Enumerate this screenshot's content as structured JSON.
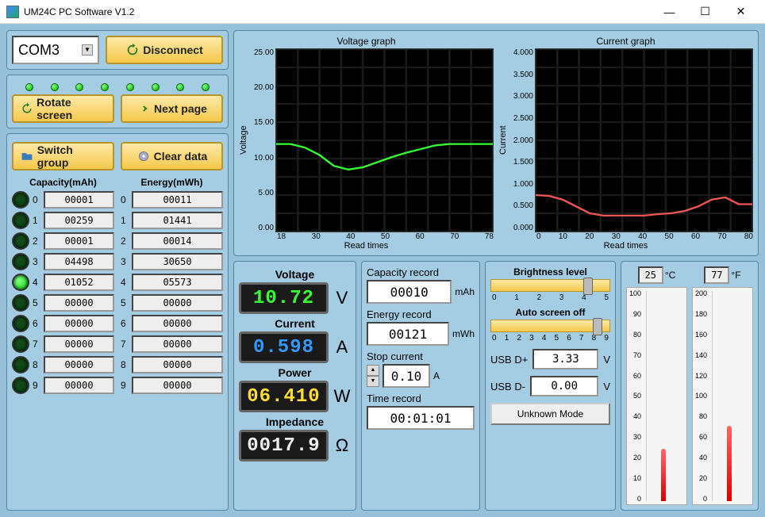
{
  "window": {
    "title": "UM24C PC Software V1.2"
  },
  "conn": {
    "port": "COM3",
    "disconnect": "Disconnect"
  },
  "nav": {
    "rotate": "Rotate screen",
    "next": "Next page",
    "switch": "Switch group",
    "clear": "Clear data"
  },
  "slots": {
    "cap_head": "Capacity(mAh)",
    "eng_head": "Energy(mWh)",
    "rows": [
      {
        "n": "0",
        "cap": "00001",
        "eng": "00011",
        "on": false
      },
      {
        "n": "1",
        "cap": "00259",
        "eng": "01441",
        "on": false
      },
      {
        "n": "2",
        "cap": "00001",
        "eng": "00014",
        "on": false
      },
      {
        "n": "3",
        "cap": "04498",
        "eng": "30650",
        "on": false
      },
      {
        "n": "4",
        "cap": "01052",
        "eng": "05573",
        "on": true
      },
      {
        "n": "5",
        "cap": "00000",
        "eng": "00000",
        "on": false
      },
      {
        "n": "6",
        "cap": "00000",
        "eng": "00000",
        "on": false
      },
      {
        "n": "7",
        "cap": "00000",
        "eng": "00000",
        "on": false
      },
      {
        "n": "8",
        "cap": "00000",
        "eng": "00000",
        "on": false
      },
      {
        "n": "9",
        "cap": "00000",
        "eng": "00000",
        "on": false
      }
    ]
  },
  "charts": {
    "voltage": {
      "title": "Voltage graph",
      "ylabel": "Voltage",
      "xlabel": "Read times",
      "yticks": [
        "25.00",
        "20.00",
        "15.00",
        "10.00",
        "5.00",
        "0.00"
      ],
      "xticks": [
        "18",
        "30",
        "40",
        "50",
        "60",
        "70",
        "78"
      ]
    },
    "current": {
      "title": "Current graph",
      "ylabel": "Current",
      "xlabel": "Read times",
      "yticks": [
        "4.000",
        "3.500",
        "3.000",
        "2.500",
        "2.000",
        "1.500",
        "1.000",
        "0.500",
        "0.000"
      ],
      "xticks": [
        "0",
        "10",
        "20",
        "30",
        "40",
        "50",
        "60",
        "70",
        "80"
      ]
    }
  },
  "chart_data": [
    {
      "type": "line",
      "title": "Voltage graph",
      "xlabel": "Read times",
      "ylabel": "Voltage",
      "xlim": [
        18,
        78
      ],
      "ylim": [
        0,
        25
      ],
      "series": [
        {
          "name": "Voltage",
          "color": "#3f3",
          "x": [
            18,
            22,
            26,
            30,
            34,
            38,
            42,
            46,
            50,
            54,
            58,
            62,
            66,
            70,
            74,
            78
          ],
          "values": [
            12.0,
            12.0,
            11.5,
            10.5,
            9.0,
            8.5,
            8.8,
            9.5,
            10.2,
            10.8,
            11.3,
            11.8,
            12.0,
            12.0,
            12.0,
            12.0
          ]
        }
      ]
    },
    {
      "type": "line",
      "title": "Current graph",
      "xlabel": "Read times",
      "ylabel": "Current",
      "xlim": [
        0,
        80
      ],
      "ylim": [
        0,
        4
      ],
      "series": [
        {
          "name": "Current",
          "color": "#e55",
          "x": [
            0,
            5,
            10,
            15,
            20,
            25,
            30,
            35,
            40,
            45,
            50,
            55,
            60,
            65,
            70,
            75,
            80
          ],
          "values": [
            0.8,
            0.78,
            0.7,
            0.55,
            0.4,
            0.35,
            0.35,
            0.35,
            0.35,
            0.38,
            0.4,
            0.45,
            0.55,
            0.7,
            0.75,
            0.6,
            0.6
          ]
        }
      ]
    }
  ],
  "meas": {
    "voltage_l": "Voltage",
    "voltage": "10.72",
    "vunit": "V",
    "current_l": "Current",
    "current": "0.598",
    "cunit": "A",
    "power_l": "Power",
    "power": "06.410",
    "punit": "W",
    "imped_l": "Impedance",
    "imped": "0017.9",
    "iunit": "Ω"
  },
  "rec": {
    "cap_l": "Capacity record",
    "cap": "00010",
    "cap_u": "mAh",
    "eng_l": "Energy record",
    "eng": "00121",
    "eng_u": "mWh",
    "stop_l": "Stop current",
    "stop": "0.10",
    "stop_u": "A",
    "time_l": "Time record",
    "time": "00:01:01"
  },
  "settings": {
    "bright_l": "Brightness level",
    "bright_ticks": [
      "0",
      "1",
      "2",
      "3",
      "4",
      "5"
    ],
    "bright_pos": 4,
    "auto_l": "Auto screen off",
    "auto_ticks": [
      "0",
      "1",
      "2",
      "3",
      "4",
      "5",
      "6",
      "7",
      "8",
      "9"
    ],
    "auto_pos": 8,
    "usb_dp_l": "USB D+",
    "usb_dp": "3.33",
    "usb_dm_l": "USB D-",
    "usb_dm": "0.00",
    "usb_u": "V",
    "mode": "Unknown Mode"
  },
  "temp": {
    "c": "25",
    "c_u": "°C",
    "f": "77",
    "f_u": "°F",
    "c_ticks": [
      "100",
      "90",
      "80",
      "70",
      "60",
      "50",
      "40",
      "30",
      "20",
      "10",
      "0"
    ],
    "f_ticks": [
      "200",
      "180",
      "160",
      "140",
      "120",
      "100",
      "80",
      "60",
      "40",
      "20",
      "0"
    ],
    "c_fill": 25,
    "f_fill": 36
  }
}
